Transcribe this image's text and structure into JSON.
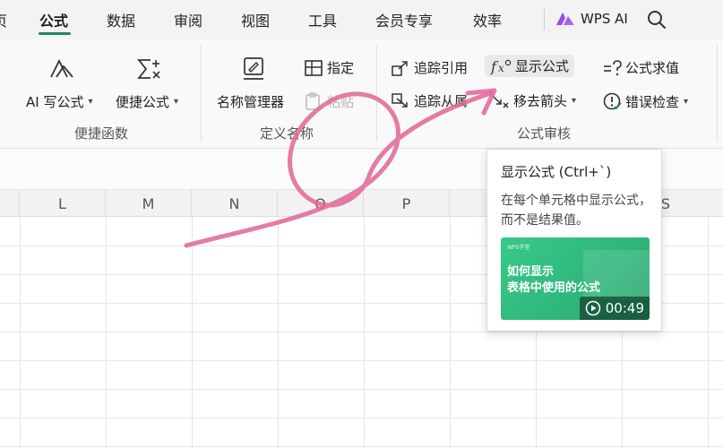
{
  "menubar": {
    "partial_left": "页",
    "tabs": [
      "公式",
      "数据",
      "审阅",
      "视图",
      "工具",
      "会员专享",
      "效率"
    ],
    "active_tab": "公式",
    "ai_label": "WPS AI"
  },
  "ribbon": {
    "shortcut_functions": {
      "ai_formula_label": "AI 写公式",
      "quick_formula_label": "便捷公式",
      "group_label": "便捷函数"
    },
    "defined_names": {
      "name_manager_label": "名称管理器",
      "specify_label": "指定",
      "paste_label": "粘贴",
      "group_label": "定义名称"
    },
    "formula_audit": {
      "trace_precedents_label": "追踪引用",
      "trace_dependents_label": "追踪从属",
      "show_formulas_label": "显示公式",
      "remove_arrows_label": "移去箭头",
      "formula_evaluate_label": "公式求值",
      "error_check_label": "错误检查",
      "group_label": "公式审核"
    }
  },
  "grid": {
    "columns": [
      "L",
      "M",
      "N",
      "O",
      "P",
      "",
      "S"
    ]
  },
  "tooltip": {
    "title": "显示公式 (Ctrl+`)",
    "description": "在每个单元格中显示公式，而不是结果值。",
    "video_brand": "WPS学堂",
    "video_title_line1": "如何显示",
    "video_title_line2": "表格中使用的公式",
    "video_duration": "00:49"
  },
  "colors": {
    "accent": "#1e8a5a",
    "scribble": "#e06a9a",
    "video_green": "#34c083"
  }
}
